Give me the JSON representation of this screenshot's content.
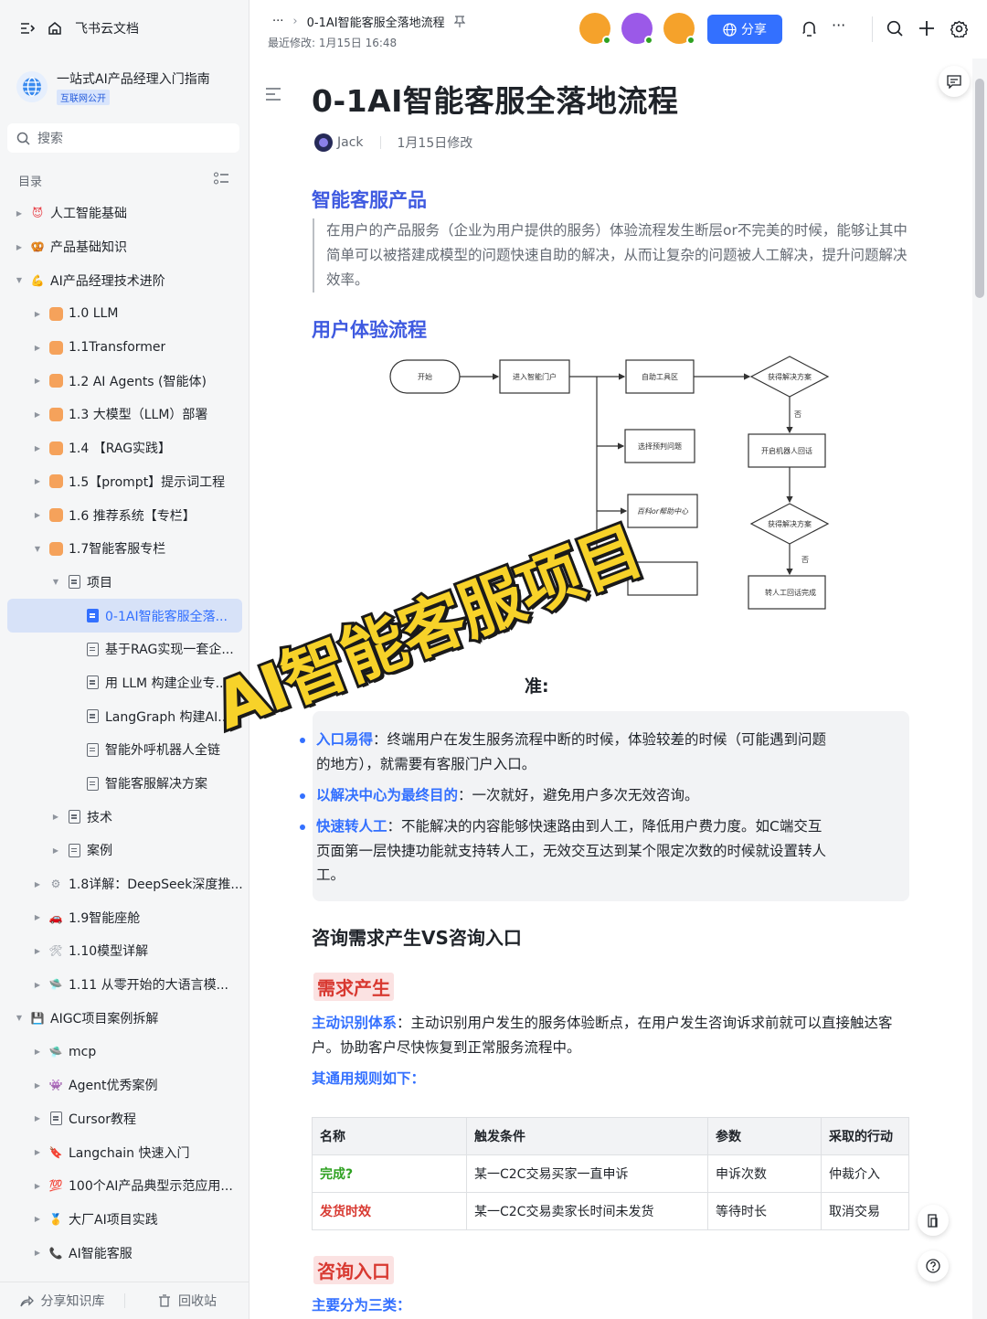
{
  "app": {
    "name": "飞书云文档"
  },
  "knowledge_base": {
    "title": "一站式AI产品经理入门指南",
    "badge": "互联网公开"
  },
  "search": {
    "label": "搜索"
  },
  "toc": {
    "label": "目录"
  },
  "tree": [
    {
      "label": "人工智能基础",
      "level": 0,
      "icon": "devil-emoji-icon",
      "color": "#e8474e",
      "arrow": "right"
    },
    {
      "label": "产品基础知识",
      "level": 0,
      "icon": "pretzel-emoji-icon",
      "color": "#f0a23a",
      "arrow": "right"
    },
    {
      "label": "AI产品经理技术进阶",
      "level": 0,
      "icon": "flex-arm-emoji-icon",
      "color": "#f5b234",
      "arrow": "down"
    },
    {
      "label": "1.0 LLM",
      "level": 1,
      "icon": "orange-square-icon",
      "color": "#f5a25b",
      "arrow": "right"
    },
    {
      "label": "1.1Transformer",
      "level": 1,
      "icon": "orange-square-icon",
      "color": "#f5a25b",
      "arrow": "right"
    },
    {
      "label": "1.2 AI Agents (智能体)",
      "level": 1,
      "icon": "orange-square-icon",
      "color": "#f5a25b",
      "arrow": "right"
    },
    {
      "label": "1.3 大模型（LLM）部署",
      "level": 1,
      "icon": "orange-square-icon",
      "color": "#f5a25b",
      "arrow": "right"
    },
    {
      "label": "1.4 【RAG实践】",
      "level": 1,
      "icon": "orange-square-icon",
      "color": "#f5a25b",
      "arrow": "right"
    },
    {
      "label": "1.5【prompt】提示词工程",
      "level": 1,
      "icon": "orange-square-icon",
      "color": "#f5a25b",
      "arrow": "right"
    },
    {
      "label": "1.6 推荐系统【专栏】",
      "level": 1,
      "icon": "orange-square-icon",
      "color": "#f5a25b",
      "arrow": "right"
    },
    {
      "label": "1.7智能客服专栏",
      "level": 1,
      "icon": "orange-square-icon",
      "color": "#f5a25b",
      "arrow": "down"
    },
    {
      "label": "项目",
      "level": 2,
      "icon": "document-icon",
      "color": "#646a73",
      "arrow": "down"
    },
    {
      "label": "0-1AI智能客服全落...",
      "level": 3,
      "icon": "document-icon",
      "color": "#3370ff",
      "arrow": "",
      "selected": true
    },
    {
      "label": "基于RAG实现一套企...",
      "level": 3,
      "icon": "document-icon",
      "color": "#646a73",
      "arrow": ""
    },
    {
      "label": "用 LLM 构建企业专...",
      "level": 3,
      "icon": "document-icon",
      "color": "#646a73",
      "arrow": ""
    },
    {
      "label": "LangGraph 构建AI...",
      "level": 3,
      "icon": "document-icon",
      "color": "#646a73",
      "arrow": ""
    },
    {
      "label": "智能外呼机器人全链",
      "level": 3,
      "icon": "document-icon",
      "color": "#646a73",
      "arrow": ""
    },
    {
      "label": "智能客服解决方案",
      "level": 3,
      "icon": "document-icon",
      "color": "#646a73",
      "arrow": ""
    },
    {
      "label": "技术",
      "level": 2,
      "icon": "document-icon",
      "color": "#646a73",
      "arrow": "right"
    },
    {
      "label": "案例",
      "level": 2,
      "icon": "document-icon",
      "color": "#646a73",
      "arrow": "right"
    },
    {
      "label": "1.8详解：DeepSeek深度推...",
      "level": 1,
      "icon": "gear-emoji-icon",
      "color": "#8f959e",
      "arrow": "right"
    },
    {
      "label": "1.9智能座舱",
      "level": 1,
      "icon": "car-emoji-icon",
      "color": "#d83931",
      "arrow": "right"
    },
    {
      "label": "1.10模型详解",
      "level": 1,
      "icon": "tools-emoji-icon",
      "color": "#8f959e",
      "arrow": "right"
    },
    {
      "label": "1.11 从零开始的大语言模...",
      "level": 1,
      "icon": "ufo-emoji-icon",
      "color": "#7aa5e8",
      "arrow": "right"
    },
    {
      "label": "AIGC项目案例拆解",
      "level": 0,
      "icon": "floppy-emoji-icon",
      "color": "#5b4a8f",
      "arrow": "down"
    },
    {
      "label": "mcp",
      "level": 1,
      "icon": "ufo-emoji-icon",
      "color": "#7aa5e8",
      "arrow": "right"
    },
    {
      "label": "Agent优秀案例",
      "level": 1,
      "icon": "alien-emoji-icon",
      "color": "#8f959e",
      "arrow": "right"
    },
    {
      "label": "Cursor教程",
      "level": 1,
      "icon": "document-icon",
      "color": "#646a73",
      "arrow": "right"
    },
    {
      "label": "Langchain 快速入门",
      "level": 1,
      "icon": "bookmark-emoji-icon",
      "color": "#e8474e",
      "arrow": "right"
    },
    {
      "label": "100个AI产品典型示范应用...",
      "level": 1,
      "icon": "hundred-emoji-icon",
      "color": "#e8474e",
      "arrow": "right"
    },
    {
      "label": "大厂AI项目实践",
      "level": 1,
      "icon": "medal-emoji-icon",
      "color": "#f5b234",
      "arrow": "right"
    },
    {
      "label": "AI智能客服",
      "level": 1,
      "icon": "phone-emoji-icon",
      "color": "#e8474e",
      "arrow": "right"
    }
  ],
  "sidebar_bottom": {
    "share": "分享知识库",
    "trash": "回收站"
  },
  "header": {
    "crumb_more": "···",
    "crumb_title": "0-1AI智能客服全落地流程",
    "modified": "最近修改: 1月15日 16:48",
    "share": "分享",
    "more": "···"
  },
  "avatars": [
    {
      "color": "#f5a22b",
      "dot": "#2ea121"
    },
    {
      "color": "#9b59e8",
      "dot": "#2ea121"
    },
    {
      "color": "#f5a22b",
      "dot": "#2ea121"
    }
  ],
  "doc": {
    "title": "0-1AI智能客服全落地流程",
    "author": "Jack",
    "edited": "1月15日修改",
    "h_product": "智能客服产品",
    "quote": "在用户的产品服务（企业为用户提供的服务）体验流程发生断层or不完美的时候，能够让其中简单可以被搭建成模型的问题快速自助的解决，从而让复杂的问题被人工解决，提升问题解决效率。",
    "h_flow": "用户体验流程",
    "flow": {
      "start": "开始",
      "portal": "进入智能门户",
      "self": "自助工具区",
      "get1": "获得解决方案",
      "no1": "否",
      "select": "选择预判问题",
      "robot": "开启机器人回话",
      "faq": "百科or帮助中心",
      "get2": "获得解决方案",
      "no2": "否",
      "human": "转人工回话完成"
    },
    "hidden_heading_tail": "准:",
    "bullets": [
      {
        "k": "入口易得",
        "v": "：终端用户在发生服务流程中断的时候，体验较差的时候（可能遇到问题的地方），就需要有客服门户入口。"
      },
      {
        "k": "以解决中心为最终目的",
        "v": "：一次就好，避免用户多次无效咨询。"
      },
      {
        "k": "快速转人工",
        "v": "：不能解决的内容能够快速路由到人工，降低用户费力度。如C端交互页面第一层快捷功能就支持转人工，无效交互达到某个限定次数的时候就设置转人工。"
      }
    ],
    "h_consult": "咨询需求产生VS咨询入口",
    "h_demand": "需求产生",
    "active_k": "主动识别体系",
    "active_v": "：主动识别用户发生的服务体验断点，在用户发生咨询诉求前就可以直接触达客户。协助客户尽快恢复到正常服务流程中。",
    "rules": "其通用规则如下：",
    "table": {
      "headers": [
        "名称",
        "触发条件",
        "参数",
        "采取的行动"
      ],
      "rows": [
        [
          "完成?",
          "某一C2C交易买家一直申诉",
          "申诉次数",
          "仲裁介入"
        ],
        [
          "发货时效",
          "某一C2C交易卖家长时间未发货",
          "等待时长",
          "取消交易"
        ]
      ]
    },
    "h_entry": "咨询入口",
    "three": "主要分为三类："
  },
  "stamp": "AI智能客服项目"
}
